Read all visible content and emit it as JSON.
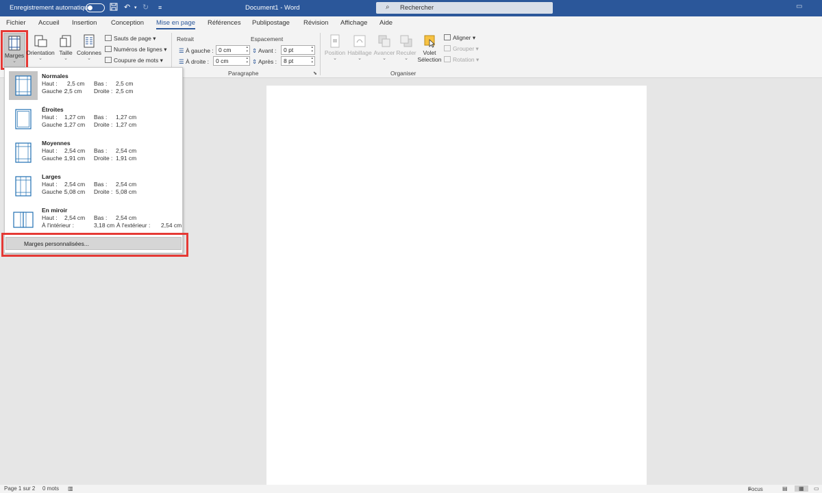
{
  "titlebar": {
    "autosave_label": "Enregistrement automatique",
    "document_title": "Document1 - Word",
    "search_placeholder": "Rechercher",
    "icons": [
      "save-icon",
      "undo-icon",
      "redo-icon",
      "customize-icon",
      "search-icon",
      "restore-icon"
    ]
  },
  "tabs": [
    "Fichier",
    "Accueil",
    "Insertion",
    "Conception",
    "Mise en page",
    "Références",
    "Publipostage",
    "Révision",
    "Affichage",
    "Aide"
  ],
  "active_tab": "Mise en page",
  "ribbon": {
    "marges": "Marges",
    "orientation": "Orientation",
    "taille": "Taille",
    "colonnes": "Colonnes",
    "sauts": "Sauts de page",
    "numeros": "Numéros de lignes",
    "coupure": "Coupure de mots",
    "retrait_title": "Retrait",
    "espacement_title": "Espacement",
    "gauche_label": "À gauche :",
    "gauche_value": "0 cm",
    "droite_label": "À droite :",
    "droite_value": "0 cm",
    "avant_label": "Avant :",
    "avant_value": "0 pt",
    "apres_label": "Après :",
    "apres_value": "8 pt",
    "paragraphe_group": "Paragraphe",
    "position": "Position",
    "habillage": "Habillage",
    "avancer": "Avancer",
    "reculer": "Reculer",
    "volet": "Volet",
    "selection": "Sélection",
    "aligner": "Aligner",
    "grouper": "Grouper",
    "rotation": "Rotation",
    "organiser_group": "Organiser"
  },
  "margins_menu": {
    "options": [
      {
        "name": "Normales",
        "line1": {
          "l1": "Haut :",
          "v1": "2,5 cm",
          "l2": "Bas :",
          "v2": "2,5 cm"
        },
        "line2": {
          "l1": "Gauche :",
          "v1": "2,5 cm",
          "l2": "Droite :",
          "v2": "2,5 cm"
        }
      },
      {
        "name": "Étroites",
        "line1": {
          "l1": "Haut :",
          "v1": "1,27 cm",
          "l2": "Bas :",
          "v2": "1,27 cm"
        },
        "line2": {
          "l1": "Gauche :",
          "v1": "1,27 cm",
          "l2": "Droite :",
          "v2": "1,27 cm"
        }
      },
      {
        "name": "Moyennes",
        "line1": {
          "l1": "Haut :",
          "v1": "2,54 cm",
          "l2": "Bas :",
          "v2": "2,54 cm"
        },
        "line2": {
          "l1": "Gauche :",
          "v1": "1,91 cm",
          "l2": "Droite :",
          "v2": "1,91 cm"
        }
      },
      {
        "name": "Larges",
        "line1": {
          "l1": "Haut :",
          "v1": "2,54 cm",
          "l2": "Bas :",
          "v2": "2,54 cm"
        },
        "line2": {
          "l1": "Gauche :",
          "v1": "5,08 cm",
          "l2": "Droite :",
          "v2": "5,08 cm"
        }
      },
      {
        "name": "En miroir",
        "line1": {
          "l1": "Haut :",
          "v1": "2,54 cm",
          "l2": "Bas :",
          "v2": "2,54 cm"
        },
        "line2": {
          "l1": "À l'intérieur :",
          "v1": "3,18 cm",
          "l2": "À l'extérieur :",
          "v2": "2,54 cm"
        }
      }
    ],
    "custom": "Marges personnalisées..."
  },
  "statusbar": {
    "page": "Page 1 sur 2",
    "words": "0 mots",
    "focus": "Focus"
  },
  "colors": {
    "titlebar": "#2b579a",
    "highlight": "#e53935"
  }
}
